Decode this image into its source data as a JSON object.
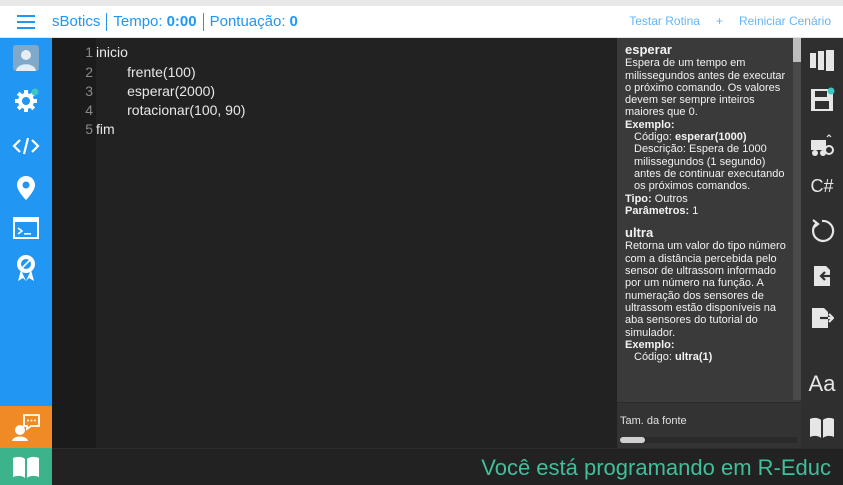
{
  "header": {
    "app_name": "sBotics",
    "time_label": "Tempo:",
    "time_value": "0:00",
    "score_label": "Pontuação:",
    "score_value": "0",
    "actions": [
      "Testar Rotina",
      "+",
      "Reiniciar Cenário"
    ]
  },
  "left_sidebar": {
    "icons": [
      "avatar-icon",
      "settings-gear-icon",
      "code-icon",
      "location-pin-icon",
      "terminal-icon",
      "badge-icon"
    ],
    "help_icon": "chat-help-icon",
    "tutorial_icon": "book-icon",
    "colors": {
      "bar": "#2196f3",
      "help": "#f08a24",
      "tutorial": "#3cb38a",
      "notify_dot": "#3ec7c0"
    }
  },
  "editor": {
    "lines": [
      {
        "num": "1",
        "code": "inicio"
      },
      {
        "num": "2",
        "code": "        frente(100)"
      },
      {
        "num": "3",
        "code": "        esperar(2000)"
      },
      {
        "num": "4",
        "code": "        rotacionar(100, 90)"
      },
      {
        "num": "5",
        "code": "fim"
      }
    ]
  },
  "docs": {
    "entries": [
      {
        "title": "esperar",
        "description": "Espera de um tempo em milissegundos antes de executar o próximo comando. Os valores devem ser sempre inteiros maiores que 0.",
        "example_label": "Exemplo:",
        "code_label": "Código:",
        "code": "esperar(1000)",
        "desc_label": "Descrição:",
        "desc": "Espera de 1000 milissegundos (1 segundo) antes de continuar executando os próximos comandos.",
        "type_label": "Tipo:",
        "type": "Outros",
        "params_label": "Parâmetros:",
        "params": "1"
      },
      {
        "title": "ultra",
        "description": "Retorna um valor do tipo número com a distância percebida pelo sensor de ultrassom informado por um número na função. A numeração dos sensores de ultrassom estão disponíveis na aba sensores do tutorial do simulador.",
        "example_label": "Exemplo:",
        "code_label": "Código:",
        "code": "ultra(1)"
      }
    ],
    "font_size_label": "Tam. da fonte",
    "font_size_fraction": 0.14
  },
  "right_toolbar": {
    "icons": [
      "layout-panel-icon",
      "save-icon",
      "robot-settings-icon",
      "csharp-text",
      "reset-icon",
      "import-icon",
      "export-icon",
      "font-size-text",
      "manual-book-icon"
    ],
    "csharp_label": "C#",
    "font_label": "Aa"
  },
  "status": {
    "text": "Você está programando em R-Educ",
    "color": "#3fbf9b"
  }
}
